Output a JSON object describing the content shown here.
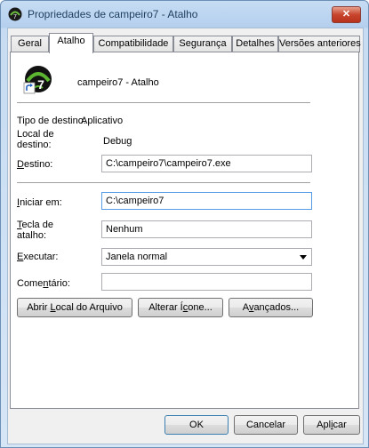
{
  "window": {
    "title": "Propriedades de campeiro7 - Atalho",
    "close_label": "✕"
  },
  "tabs": [
    {
      "label": "Geral"
    },
    {
      "label": "Atalho"
    },
    {
      "label": "Compatibilidade"
    },
    {
      "label": "Segurança"
    },
    {
      "label": "Detalhes"
    },
    {
      "label": "Versões anteriores"
    }
  ],
  "header": {
    "name": "campeiro7 - Atalho"
  },
  "fields": {
    "target_type_label": "Tipo de destino:",
    "target_type_value": "Aplicativo",
    "target_location_label": "Local de destino:",
    "target_location_value": "Debug",
    "target_label": "Destino:",
    "target_value": "C:\\campeiro7\\campeiro7.exe",
    "start_in_label": "Iniciar em:",
    "start_in_value": "C:\\campeiro7",
    "shortcut_key_label": "Tecla de atalho:",
    "shortcut_key_value": "Nenhum",
    "run_label": "Executar:",
    "run_value": "Janela normal",
    "comment_label": "Comentário:",
    "comment_value": ""
  },
  "buttons": {
    "open_location": "Abrir Local do Arquivo",
    "change_icon": "Alterar Ícone...",
    "advanced": "Avançados...",
    "ok": "OK",
    "cancel": "Cancelar",
    "apply": "Aplicar"
  },
  "icons": {
    "app_icon": "campeiro-app-icon",
    "shortcut_arrow": "shortcut-arrow-icon"
  }
}
